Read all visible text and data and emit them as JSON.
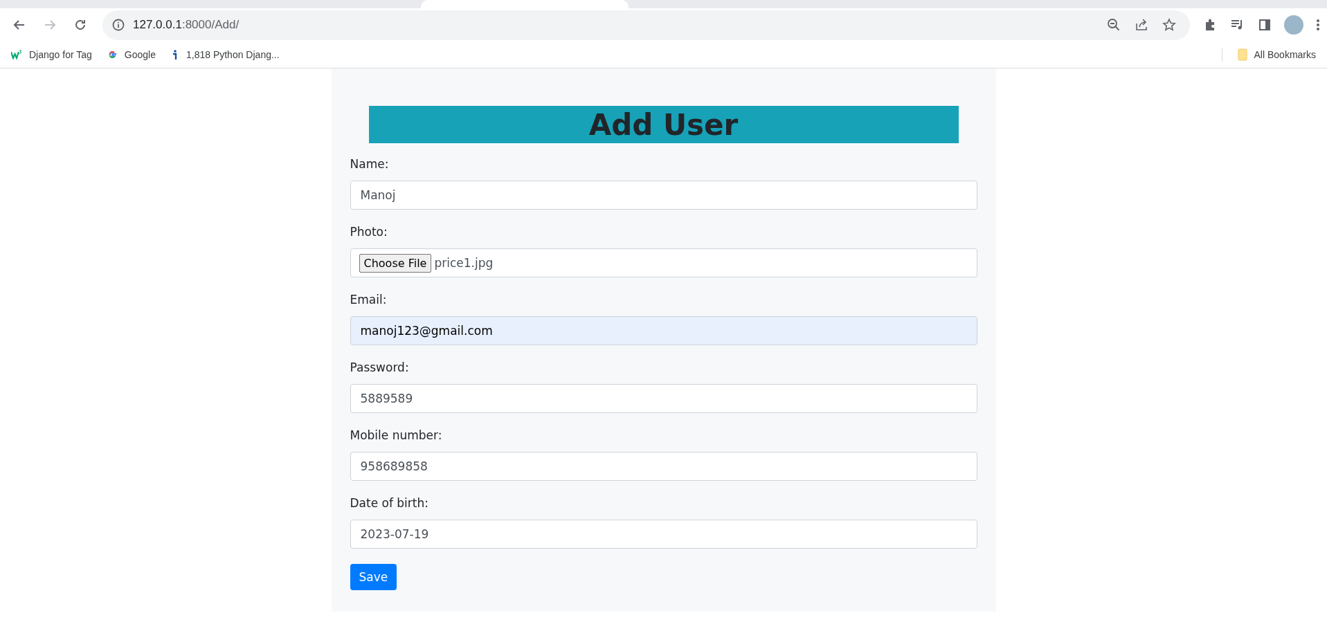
{
  "browser": {
    "address": {
      "host": "127.0.0.1",
      "path": ":8000/Add/"
    },
    "bookmarks": [
      {
        "label": "Django for Tag",
        "kind": "w3"
      },
      {
        "label": "Google",
        "kind": "google"
      },
      {
        "label": "1,818 Python Djang...",
        "kind": "info"
      }
    ],
    "all_bookmarks": "All Bookmarks"
  },
  "form": {
    "title": "Add User",
    "fields": [
      {
        "label": "Name:",
        "kind": "text",
        "value": "Manoj",
        "autofilled": false
      },
      {
        "label": "Photo:",
        "kind": "file",
        "button": "Choose File",
        "value": "price1.jpg",
        "autofilled": false
      },
      {
        "label": "Email:",
        "kind": "text",
        "value": "manoj123@gmail.com",
        "autofilled": true
      },
      {
        "label": "Password:",
        "kind": "text",
        "value": "5889589",
        "autofilled": false
      },
      {
        "label": "Mobile number:",
        "kind": "text",
        "value": "958689858",
        "autofilled": false
      },
      {
        "label": "Date of birth:",
        "kind": "text",
        "value": "2023-07-19",
        "autofilled": false
      }
    ],
    "submit": "Save"
  }
}
